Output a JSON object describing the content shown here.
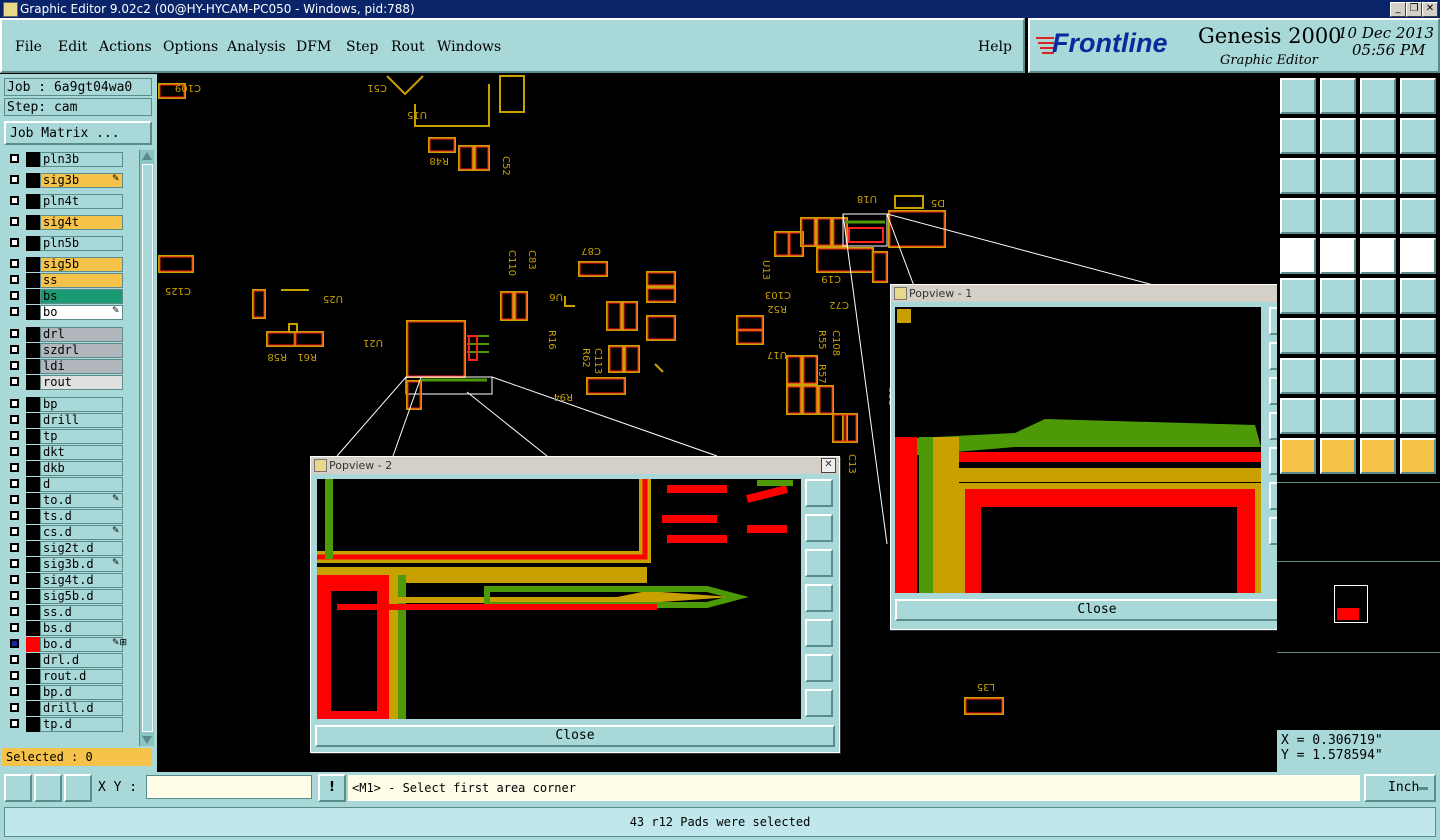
{
  "window": {
    "title": "Graphic Editor 9.02c2 (00@HY-HYCAM-PC050 - Windows, pid:788)",
    "min_icon": "minimize-icon",
    "max_icon": "restore-icon",
    "close_icon": "close-icon"
  },
  "menu": {
    "items": [
      "File",
      "Edit",
      "Actions",
      "Options",
      "Analysis",
      "DFM",
      "Step",
      "Rout",
      "Windows"
    ],
    "help": "Help"
  },
  "brand": {
    "logo_text": "Frontline",
    "product": "Genesis 2000",
    "subtitle": "Graphic Editor",
    "date": "10 Dec 2013",
    "time": "05:56 PM"
  },
  "job": {
    "job_label": "Job : 6a9gt04wa0",
    "step_label": "Step: cam",
    "matrix_button": "Job Matrix ..."
  },
  "layers": [
    {
      "name": "pln3b",
      "color": "#a8d8d8",
      "swatch": "#000000"
    },
    {
      "name": "sig3b",
      "color": "#f5c24a",
      "swatch": "#000000",
      "flag": "✎"
    },
    {
      "name": "pln4t",
      "color": "#a8d8d8",
      "swatch": "#000000"
    },
    {
      "name": "sig4t",
      "color": "#f5c24a",
      "swatch": "#000000"
    },
    {
      "name": "pln5b",
      "color": "#a8d8d8",
      "swatch": "#000000"
    },
    {
      "name": "sig5b",
      "color": "#f5c24a",
      "swatch": "#000000"
    },
    {
      "name": "ss",
      "color": "#f5c24a",
      "swatch": "#000000"
    },
    {
      "name": "bs",
      "color": "#1a9a72",
      "swatch": "#000000"
    },
    {
      "name": "bo",
      "color": "#ffffff",
      "swatch": "#000000",
      "flag": "✎"
    },
    {
      "name": "drl",
      "color": "#b0b6bc",
      "swatch": "#000000"
    },
    {
      "name": "szdrl",
      "color": "#b0b6bc",
      "swatch": "#000000"
    },
    {
      "name": "ldi",
      "color": "#b0b6bc",
      "swatch": "#000000"
    },
    {
      "name": "rout",
      "color": "#e0e0e0",
      "swatch": "#000000"
    },
    {
      "name": "bp",
      "color": "#a8d8d8",
      "swatch": "#000000"
    },
    {
      "name": "drill",
      "color": "#a8d8d8",
      "swatch": "#000000"
    },
    {
      "name": "tp",
      "color": "#a8d8d8",
      "swatch": "#000000"
    },
    {
      "name": "dkt",
      "color": "#a8d8d8",
      "swatch": "#000000"
    },
    {
      "name": "dkb",
      "color": "#a8d8d8",
      "swatch": "#000000"
    },
    {
      "name": "d",
      "color": "#a8d8d8",
      "swatch": "#000000"
    },
    {
      "name": "to.d",
      "color": "#a8d8d8",
      "swatch": "#000000",
      "flag": "✎"
    },
    {
      "name": "ts.d",
      "color": "#a8d8d8",
      "swatch": "#000000"
    },
    {
      "name": "cs.d",
      "color": "#a8d8d8",
      "swatch": "#000000",
      "flag": "✎"
    },
    {
      "name": "sig2t.d",
      "color": "#a8d8d8",
      "swatch": "#000000"
    },
    {
      "name": "sig3b.d",
      "color": "#a8d8d8",
      "swatch": "#000000",
      "flag": "✎"
    },
    {
      "name": "sig4t.d",
      "color": "#a8d8d8",
      "swatch": "#000000"
    },
    {
      "name": "sig5b.d",
      "color": "#a8d8d8",
      "swatch": "#000000"
    },
    {
      "name": "ss.d",
      "color": "#a8d8d8",
      "swatch": "#000000"
    },
    {
      "name": "bs.d",
      "color": "#a8d8d8",
      "swatch": "#000000"
    },
    {
      "name": "bo.d",
      "color": "#a8d8d8",
      "swatch": "#ff0000",
      "flag": "✎⊞",
      "active": true
    },
    {
      "name": "drl.d",
      "color": "#a8d8d8",
      "swatch": "#000000"
    },
    {
      "name": "rout.d",
      "color": "#a8d8d8",
      "swatch": "#000000"
    },
    {
      "name": "bp.d",
      "color": "#a8d8d8",
      "swatch": "#000000"
    },
    {
      "name": "drill.d",
      "color": "#a8d8d8",
      "swatch": "#000000"
    },
    {
      "name": "tp.d",
      "color": "#a8d8d8",
      "swatch": "#000000"
    }
  ],
  "selected": "Selected : 0",
  "canvas_labels": {
    "c109": "C109",
    "c51": "C51",
    "u15": "U15",
    "r48": "R48",
    "c52": "C52",
    "c125": "C125",
    "u25": "U25",
    "r58": "R58",
    "r61": "R61",
    "u21": "U21",
    "c87": "C87",
    "c110": "C110",
    "c83": "C83",
    "u6": "U6",
    "r16": "R16",
    "r62": "R62",
    "c113": "C113",
    "r94": "R94",
    "u18": "U18",
    "d5": "D5",
    "c19": "C19",
    "c72": "C72",
    "r52": "R52",
    "c103": "C103",
    "u17": "U17",
    "u13": "U13",
    "c13": "C13",
    "l35": "L35",
    "r55": "R55",
    "c108": "C108",
    "r57": "R57",
    "c11": "C11"
  },
  "popview1": {
    "title": "Popview - 1",
    "close": "Close"
  },
  "popview2": {
    "title": "Popview - 2",
    "close": "Close"
  },
  "coords": {
    "x": "X = 0.306719\"",
    "y": "Y = 1.578594\""
  },
  "command": {
    "xy_label": "X Y :",
    "xy_value": "",
    "prompt": "<M1> - Select first area corner",
    "units": "Inch"
  },
  "status": "43 r12 Pads were selected",
  "colors": {
    "panel": "#a8d8d8",
    "signal": "#ff0000",
    "mask": "#4e9a06",
    "outline": "#c8a000",
    "highlight": "#f5c24a"
  }
}
